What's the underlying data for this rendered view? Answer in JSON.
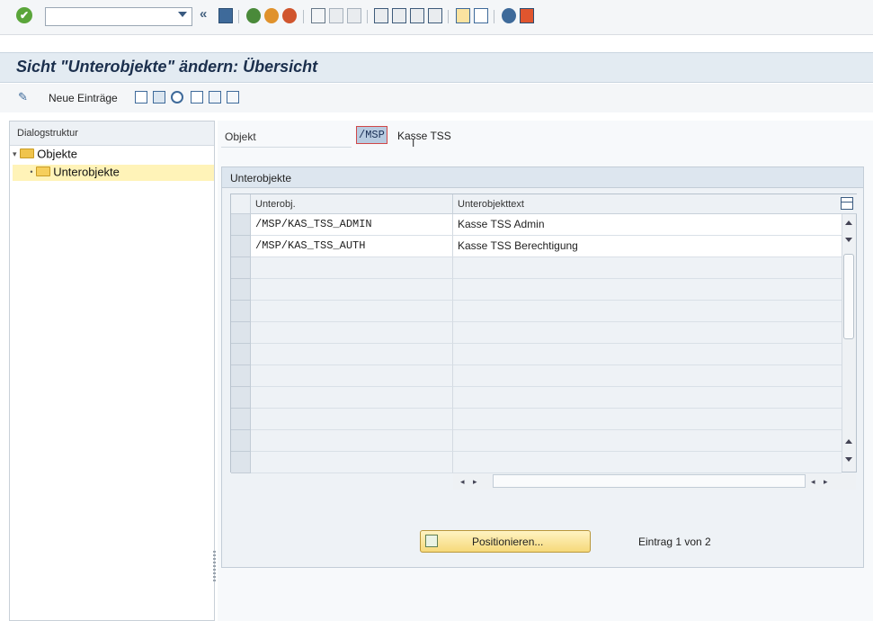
{
  "systembar": {
    "command_field_value": "",
    "icons": [
      "check-icon",
      "collapse-icon",
      "save-icon",
      "back-icon",
      "exit-icon",
      "cancel-icon",
      "print-icon",
      "find-icon",
      "find-next-icon",
      "first-page-icon",
      "previous-page-icon",
      "next-page-icon",
      "last-page-icon",
      "create-session-icon",
      "create-shortcut-icon",
      "help-icon",
      "customize-layout-icon"
    ]
  },
  "title": "Sicht \"Unterobjekte\" ändern: Übersicht",
  "apptoolbar": {
    "new_entries_label": "Neue Einträge",
    "icons": [
      "copy-as-icon",
      "delete-icon",
      "undo-icon",
      "select-all-icon",
      "select-block-icon",
      "deselect-all-icon"
    ]
  },
  "tree": {
    "header": "Dialogstruktur",
    "nodes": [
      {
        "label": "Objekte",
        "selected": false
      },
      {
        "label": "Unterobjekte",
        "selected": true
      }
    ]
  },
  "objekt": {
    "label": "Objekt",
    "value": "/MSP",
    "description": "Kasse TSS"
  },
  "group": {
    "title": "Unterobjekte"
  },
  "table": {
    "columns": [
      "Unterobj.",
      "Unterobjekttext"
    ],
    "rows": [
      {
        "unterobj": "/MSP/KAS_TSS_ADMIN",
        "text": "Kasse TSS Admin"
      },
      {
        "unterobj": "/MSP/KAS_TSS_AUTH",
        "text": "Kasse TSS Berechtigung"
      }
    ]
  },
  "footer": {
    "position_button": "Positionieren...",
    "entry_info": "Eintrag 1 von 2"
  },
  "colors": {
    "title_text": "#1b2f4d",
    "selected_node": "#fff3b8",
    "button_gradient_end": "#f6d97a"
  }
}
